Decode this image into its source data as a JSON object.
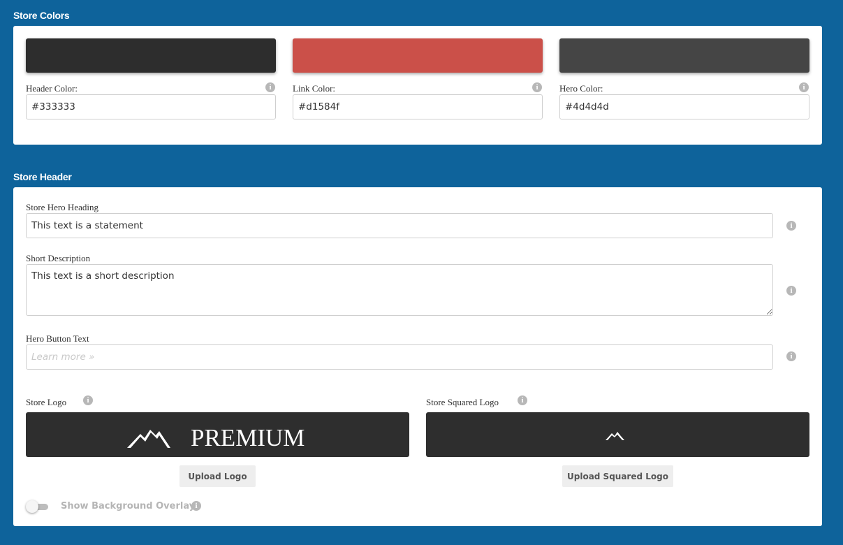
{
  "store_colors": {
    "title": "Store Colors",
    "fields": [
      {
        "label": "Header Color:",
        "value": "#333333",
        "swatch": "#2d2d2d"
      },
      {
        "label": "Link Color:",
        "value": "#d1584f",
        "swatch": "#cb5049"
      },
      {
        "label": "Hero Color:",
        "value": "#4d4d4d",
        "swatch": "#454545"
      }
    ],
    "info_icon": "info-icon"
  },
  "store_header": {
    "title": "Store Header",
    "hero_heading": {
      "label": "Store Hero Heading",
      "value": "This text is a statement"
    },
    "short_description": {
      "label": "Short Description",
      "value": "This text is a short description"
    },
    "hero_button_text": {
      "label": "Hero Button Text",
      "placeholder": "Learn more »"
    },
    "store_logo": {
      "label": "Store Logo",
      "logo_text": "PREMIUM",
      "upload_label": "Upload Logo"
    },
    "squared_logo": {
      "label": "Store Squared Logo",
      "upload_label": "Upload Squared Logo"
    },
    "background_overlay": {
      "label": "Show Background Overlay",
      "enabled": false
    }
  },
  "colors": {
    "page_background": "#0e639b",
    "logo_background": "#2e2e2e"
  }
}
